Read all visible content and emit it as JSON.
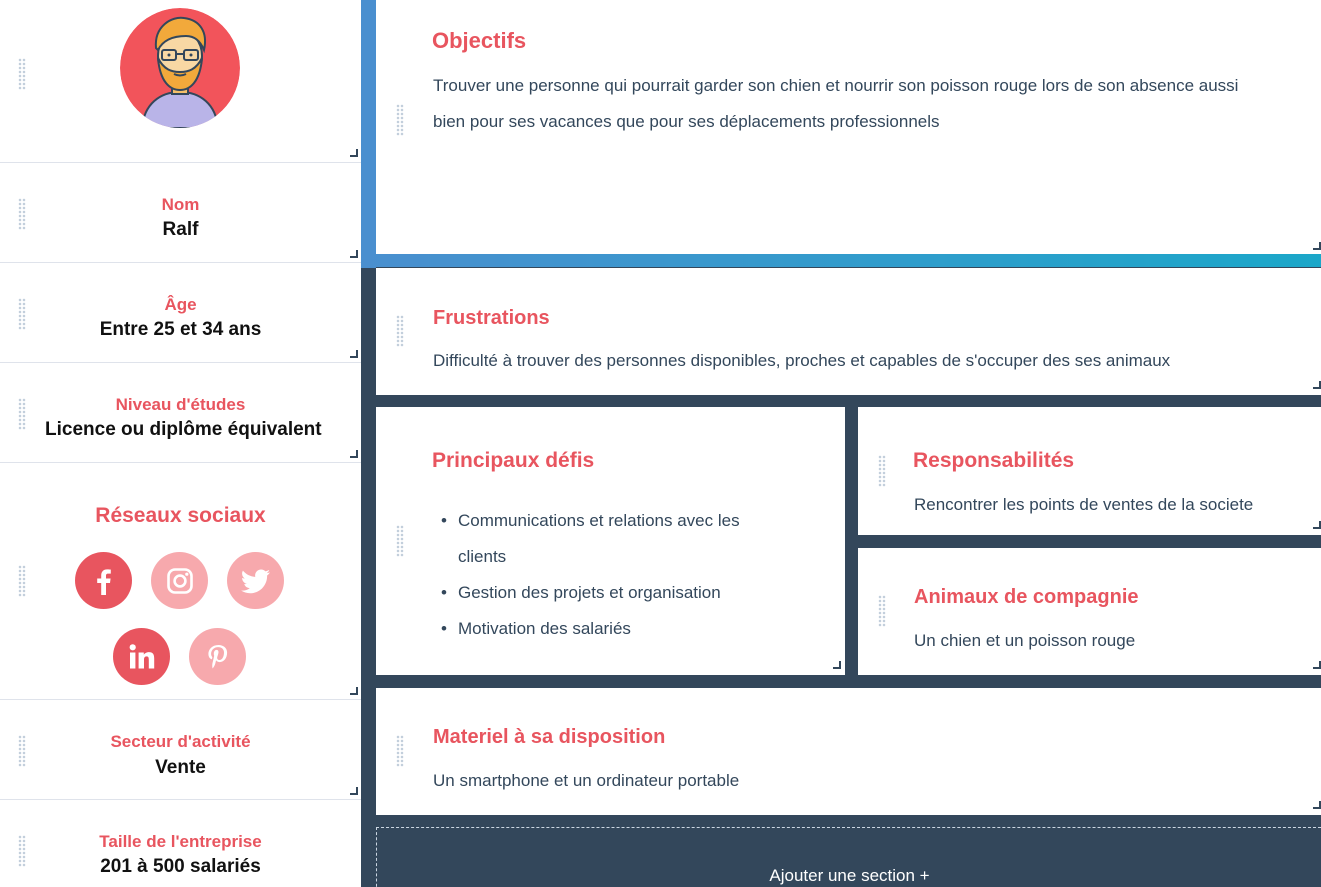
{
  "sidebar": {
    "name": {
      "label": "Nom",
      "value": "Ralf"
    },
    "age": {
      "label": "Âge",
      "value": "Entre 25 et 34 ans"
    },
    "education": {
      "label": "Niveau d'études",
      "value": "Licence ou diplôme équivalent"
    },
    "social": {
      "title": "Réseaux sociaux",
      "networks": [
        "facebook",
        "instagram",
        "twitter",
        "linkedin",
        "pinterest"
      ]
    },
    "industry": {
      "label": "Secteur d'activité",
      "value": "Vente"
    },
    "company_size": {
      "label": "Taille de l'entreprise",
      "value": "201 à 500 salariés"
    }
  },
  "main": {
    "objectives": {
      "title": "Objectifs",
      "text": "Trouver une personne qui pourrait garder son chien et nourrir son poisson rouge lors de son absence aussi bien pour ses vacances que pour ses déplacements professionnels"
    },
    "frustrations": {
      "title": "Frustrations",
      "text": "Difficulté à trouver des personnes disponibles, proches et capables de s'occuper des ses animaux"
    },
    "challenges": {
      "title": "Principaux défis",
      "items": [
        "Communications et relations avec les clients",
        "Gestion des projets et organisation",
        "Motivation des salariés"
      ]
    },
    "responsibilities": {
      "title": "Responsabilités",
      "text": "Rencontrer les points de ventes de la societe"
    },
    "pets": {
      "title": "Animaux de compagnie",
      "text": "Un chien et un poisson rouge"
    },
    "equipment": {
      "title": "Materiel à sa disposition",
      "text": "Un smartphone et un ordinateur portable"
    },
    "add_section_label": "Ajouter une section +"
  },
  "colors": {
    "accent": "#e8555f",
    "accent_light": "#f7a9ad",
    "background_dark": "#33475b",
    "blue": "#4a8fcf"
  }
}
